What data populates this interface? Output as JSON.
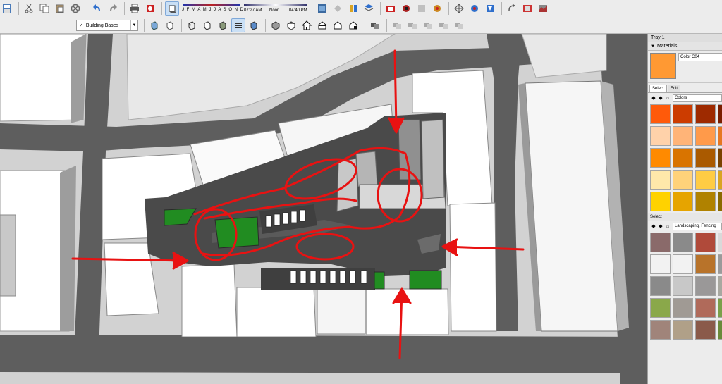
{
  "toolbar": {
    "months": "J F M A M J J A S O N D",
    "time_start": "07:27 AM",
    "time_noon": "Noon",
    "time_end": "04:40 PM",
    "style_label": "Building Bases"
  },
  "tray": {
    "title": "Tray 1",
    "materials_header": "Materials",
    "current_material": "Color C04",
    "tab_select": "Select",
    "tab_edit": "Edit",
    "library_1": "Colors",
    "select_label": "Select",
    "library_2": "Landscaping, Fencing",
    "colors": [
      "#ff5a0a",
      "#cc3c00",
      "#9e2a00",
      "#7a1e00",
      "#ffd2aa",
      "#ffb478",
      "#ff9a4a",
      "#e67722",
      "#ff8a00",
      "#d97400",
      "#aa5a00",
      "#7a4200",
      "#ffe8aa",
      "#ffd27a",
      "#ffcc44",
      "#d9a422",
      "#ffd200",
      "#e6a400",
      "#b08200",
      "#8a6a00"
    ],
    "textures": [
      "#8a6a6a",
      "#8a8a8a",
      "#b04a3a",
      "#d9d9d9",
      "#f2f2f2",
      "#f2f2f2",
      "#b8732a",
      "#9a9a9a",
      "#8a8a8a",
      "#c8c8c8",
      "#9a9898",
      "#a8a8a0",
      "#8aa84a",
      "#a09a94",
      "#b06a5a",
      "#7aa04a",
      "#a0847a",
      "#b0a088",
      "#8a5a4a",
      "#6a8a3a"
    ]
  },
  "icons": {
    "row1": [
      "save-icon",
      "cut-icon",
      "copy-icon",
      "paste-icon",
      "erase-icon",
      "undo-icon",
      "redo-icon",
      "print-icon",
      "model-info-icon",
      "shadows-toggle-icon",
      "components-icon",
      "materials-icon",
      "styles-icon",
      "layers-icon",
      "scenes-icon",
      "shadows-icon",
      "fog-icon",
      "soften-edges-icon",
      "warehouse-icon",
      "share-model-icon",
      "extension-icon",
      "solid-tools-icon"
    ],
    "row2": [
      "xray-icon",
      "back-edges-icon",
      "wireframe-icon",
      "hidden-line-icon",
      "shaded-icon",
      "shaded-textures-icon",
      "monochrome-icon",
      "iso-view-icon",
      "top-view-icon",
      "front-view-icon",
      "right-view-icon",
      "back-view-icon",
      "left-view-icon",
      "outer-shell-icon",
      "intersect-icon",
      "union-icon",
      "subtract-icon",
      "trim-icon",
      "split-icon"
    ]
  }
}
